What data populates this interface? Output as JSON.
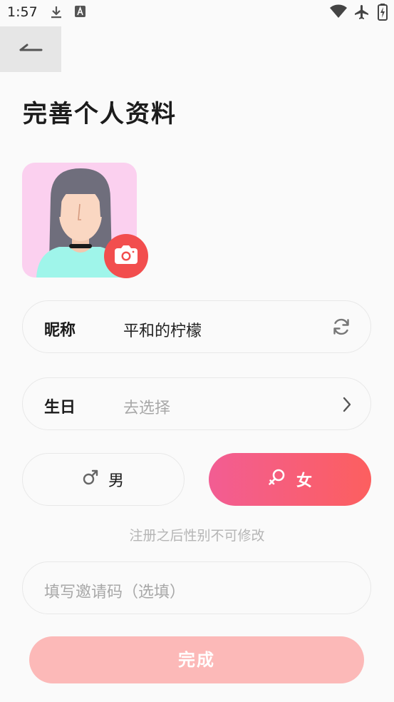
{
  "status_bar": {
    "time": "1:57"
  },
  "header": {
    "title": "完善个人资料"
  },
  "nickname": {
    "label": "昵称",
    "value": "平和的柠檬"
  },
  "birthday": {
    "label": "生日",
    "placeholder": "去选择"
  },
  "gender": {
    "male_label": "男",
    "female_label": "女",
    "selected": "female",
    "note": "注册之后性别不可修改"
  },
  "invite": {
    "placeholder": "填写邀请码（选填）"
  },
  "submit": {
    "label": "完成"
  },
  "colors": {
    "accent": "#f24e4e",
    "gradient_start": "#f25d93",
    "gradient_end": "#fc5f5f",
    "submit_disabled": "#fcb9b8"
  }
}
